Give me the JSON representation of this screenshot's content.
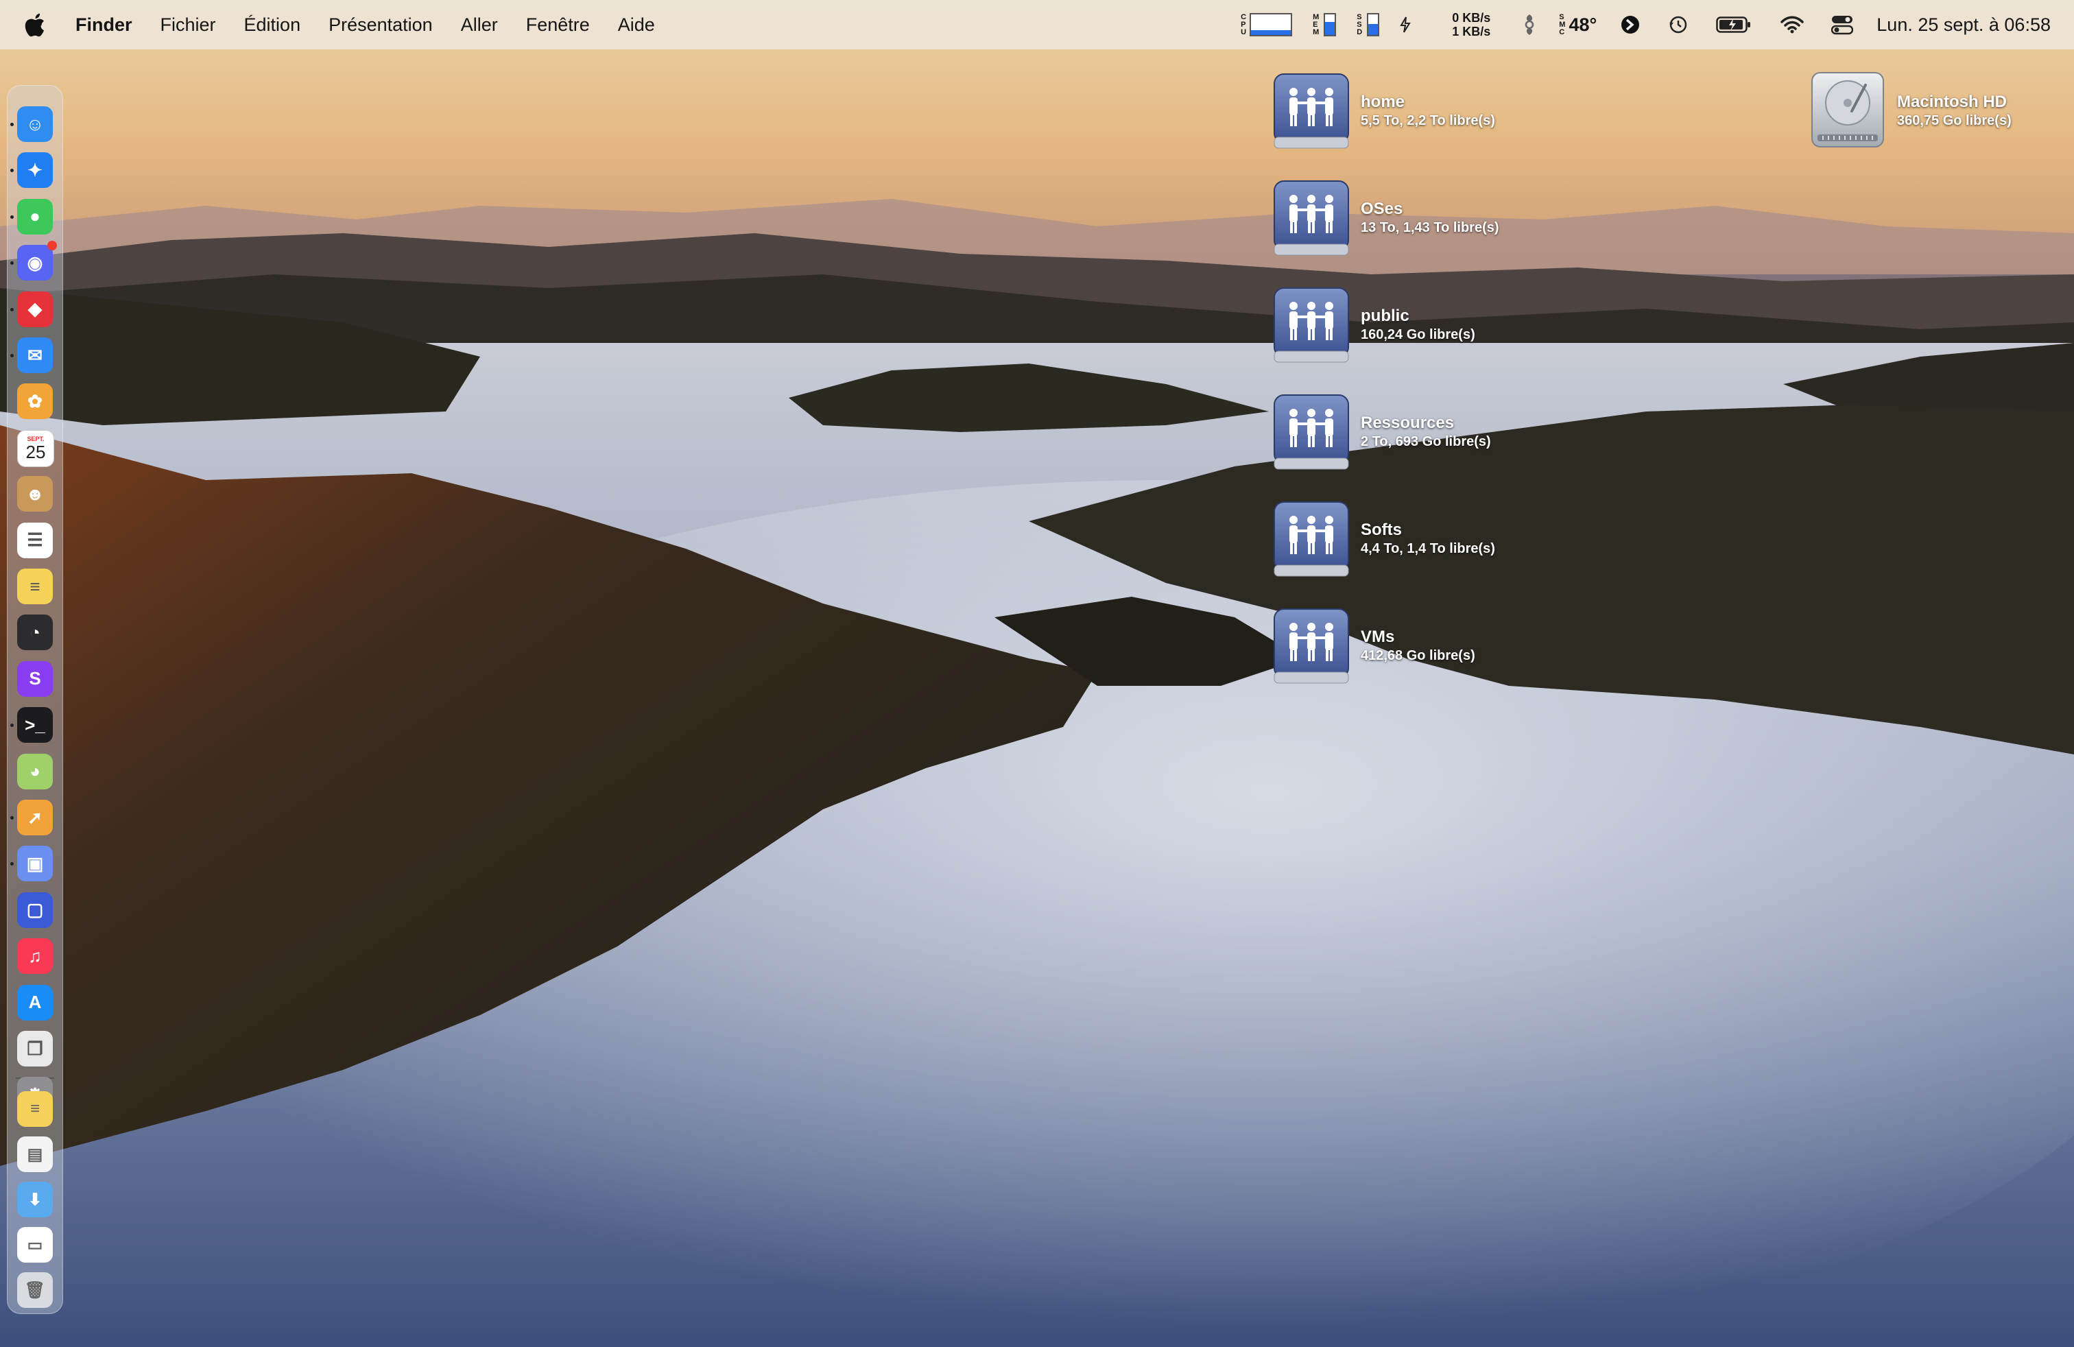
{
  "menubar": {
    "apple_icon": "apple-logo-icon",
    "app_name": "Finder",
    "menus": [
      "Fichier",
      "Édition",
      "Présentation",
      "Aller",
      "Fenêtre",
      "Aide"
    ],
    "status": {
      "cpu_label": [
        "C",
        "P",
        "U"
      ],
      "cpu_load_fraction": 0.22,
      "mem_label": [
        "M",
        "E",
        "M"
      ],
      "mem_fraction": 0.65,
      "ssd_label": [
        "S",
        "S",
        "D"
      ],
      "ssd_fraction": 0.55,
      "net_down": "0 KB/s",
      "net_up": "1 KB/s",
      "sensor_label": [
        "S",
        "M",
        "C"
      ],
      "temperature": "48°",
      "clock": "Lun. 25 sept. à 06:58"
    }
  },
  "desktop": {
    "volumes": [
      {
        "name": "home",
        "info": "5,5 To, 2,2 To libre(s)",
        "icon": "network-share-icon"
      },
      {
        "name": "OSes",
        "info": "13 To, 1,43 To libre(s)",
        "icon": "network-share-icon"
      },
      {
        "name": "public",
        "info": "160,24 Go libre(s)",
        "icon": "network-share-icon"
      },
      {
        "name": "Ressources",
        "info": "2 To, 693 Go libre(s)",
        "icon": "network-share-icon"
      },
      {
        "name": "Softs",
        "info": "4,4 To, 1,4 To libre(s)",
        "icon": "network-share-icon"
      },
      {
        "name": "VMs",
        "info": "412,68 Go libre(s)",
        "icon": "network-share-icon"
      }
    ],
    "internal_disk": {
      "name": "Macintosh HD",
      "info": "360,75 Go libre(s)",
      "icon": "hard-disk-icon"
    }
  },
  "dock": {
    "calendar_month": "SEPT.",
    "calendar_day": "25",
    "apps": [
      {
        "icon": "finder-icon",
        "color": "#2f8cf0",
        "running": true
      },
      {
        "icon": "safari-icon",
        "color": "#1e7ef2",
        "running": true
      },
      {
        "icon": "messages-icon",
        "color": "#3cc85a",
        "running": true
      },
      {
        "icon": "discord-icon",
        "color": "#5865f2",
        "running": true,
        "badge": true
      },
      {
        "icon": "speeko-icon",
        "color": "#e8323a",
        "running": true
      },
      {
        "icon": "mail-icon",
        "color": "#2f8af5",
        "running": true
      },
      {
        "icon": "photos-icon",
        "color": "#f2a436",
        "running": false
      },
      {
        "icon": "calendar-icon",
        "color": "#ffffff",
        "running": false
      },
      {
        "icon": "contacts-icon",
        "color": "#c9995a",
        "running": false
      },
      {
        "icon": "reminders-icon",
        "color": "#ffffff",
        "running": false
      },
      {
        "icon": "notes-icon",
        "color": "#f5d35a",
        "running": false
      },
      {
        "icon": "activity-monitor-icon",
        "color": "#2c2c2e",
        "running": false
      },
      {
        "icon": "setapp-icon",
        "color": "#8a3cf0",
        "running": false
      },
      {
        "icon": "terminal-icon",
        "color": "#1c1c1e",
        "running": true
      },
      {
        "icon": "cyberduck-icon",
        "color": "#9fd06a",
        "running": false
      },
      {
        "icon": "transmit-icon",
        "color": "#f2a23a",
        "running": true
      },
      {
        "icon": "archive-utility-icon",
        "color": "#6a8ff0",
        "running": true
      },
      {
        "icon": "screens-icon",
        "color": "#3a5ad8",
        "running": false
      },
      {
        "icon": "music-icon",
        "color": "#fa3a55",
        "running": false
      },
      {
        "icon": "app-store-icon",
        "color": "#1a8cf5",
        "running": false
      },
      {
        "icon": "preview-icon",
        "color": "#e8e8e8",
        "running": false
      },
      {
        "icon": "system-settings-icon",
        "color": "#8e8e93",
        "running": false
      }
    ],
    "stack": [
      {
        "icon": "notes-stack-icon",
        "color": "#f5d05a"
      },
      {
        "icon": "document-stack-icon",
        "color": "#f4f4f4"
      },
      {
        "icon": "downloads-folder-icon",
        "color": "#5aaaf0"
      },
      {
        "icon": "screenshot-stack-icon",
        "color": "#ffffff"
      },
      {
        "icon": "trash-icon",
        "color": "#d8dbe0"
      }
    ]
  }
}
